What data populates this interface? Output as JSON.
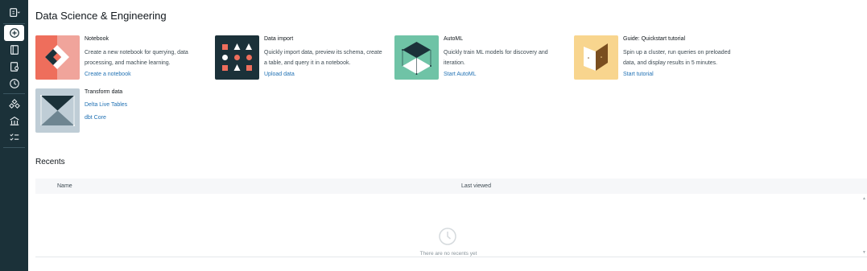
{
  "page": {
    "title": "Data Science & Engineering"
  },
  "sidebar": {
    "items": [
      {
        "icon": "workspace-switcher-icon"
      },
      {
        "icon": "new-plus-icon",
        "active": true
      },
      {
        "icon": "workspace-icon"
      },
      {
        "icon": "repos-icon"
      },
      {
        "icon": "recents-clock-icon"
      },
      {
        "icon": "data-icon"
      },
      {
        "icon": "compute-icon"
      },
      {
        "icon": "workflows-icon"
      }
    ]
  },
  "cards": {
    "notebook": {
      "title": "Notebook",
      "description": "Create a new notebook for querying, data processing, and machine learning.",
      "link": "Create a notebook"
    },
    "data_import": {
      "title": "Data import",
      "description": "Quickly import data, preview its schema, create a table, and query it in a notebook.",
      "link": "Upload data"
    },
    "automl": {
      "title": "AutoML",
      "description": "Quickly train ML models for discovery and iteration.",
      "link": "Start AutoML"
    },
    "guide": {
      "title": "Guide: Quickstart tutorial",
      "description": "Spin up a cluster, run queries on preloaded data, and display results in 5 minutes.",
      "link": "Start tutorial"
    },
    "transform": {
      "title": "Transform data",
      "link1": "Delta Live Tables",
      "link2": "dbt Core"
    }
  },
  "recents": {
    "title": "Recents",
    "columns": [
      "Name",
      "Last viewed"
    ],
    "empty_text": "There are no recents yet"
  },
  "colors": {
    "sidebar_bg": "#1b3139",
    "link": "#2272b4",
    "notebook_bg": "#f0a49b",
    "import_bg": "#1b3139",
    "automl_bg": "#6fc3a6",
    "guide_bg": "#f8d58e",
    "transform_bg": "#bfcdd6"
  }
}
